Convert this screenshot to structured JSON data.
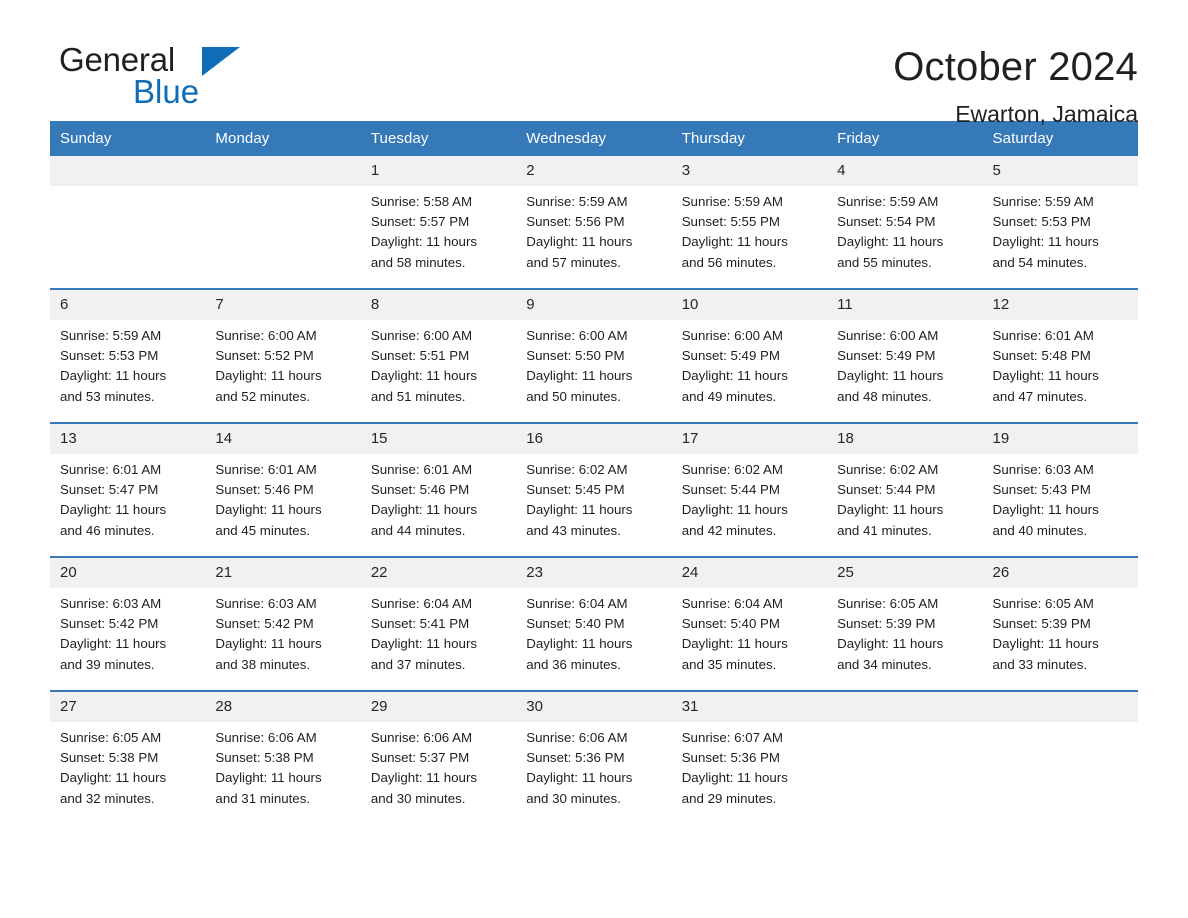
{
  "brand": {
    "name_top": "General",
    "name_bottom": "Blue",
    "triangle_color": "#0f6cb6"
  },
  "header": {
    "title": "October 2024",
    "subtitle": "Ewarton, Jamaica"
  },
  "theme": {
    "header_blue": "#3579b8",
    "row_divider_blue": "#3579b8",
    "daynum_bg": "#f1f1f1",
    "page_bg": "#ffffff"
  },
  "weekday_headers": [
    "Sunday",
    "Monday",
    "Tuesday",
    "Wednesday",
    "Thursday",
    "Friday",
    "Saturday"
  ],
  "weeks": [
    [
      {
        "day": "",
        "lines": []
      },
      {
        "day": "",
        "lines": []
      },
      {
        "day": "1",
        "lines": [
          "Sunrise: 5:58 AM",
          "Sunset: 5:57 PM",
          "Daylight: 11 hours",
          "and 58 minutes."
        ]
      },
      {
        "day": "2",
        "lines": [
          "Sunrise: 5:59 AM",
          "Sunset: 5:56 PM",
          "Daylight: 11 hours",
          "and 57 minutes."
        ]
      },
      {
        "day": "3",
        "lines": [
          "Sunrise: 5:59 AM",
          "Sunset: 5:55 PM",
          "Daylight: 11 hours",
          "and 56 minutes."
        ]
      },
      {
        "day": "4",
        "lines": [
          "Sunrise: 5:59 AM",
          "Sunset: 5:54 PM",
          "Daylight: 11 hours",
          "and 55 minutes."
        ]
      },
      {
        "day": "5",
        "lines": [
          "Sunrise: 5:59 AM",
          "Sunset: 5:53 PM",
          "Daylight: 11 hours",
          "and 54 minutes."
        ]
      }
    ],
    [
      {
        "day": "6",
        "lines": [
          "Sunrise: 5:59 AM",
          "Sunset: 5:53 PM",
          "Daylight: 11 hours",
          "and 53 minutes."
        ]
      },
      {
        "day": "7",
        "lines": [
          "Sunrise: 6:00 AM",
          "Sunset: 5:52 PM",
          "Daylight: 11 hours",
          "and 52 minutes."
        ]
      },
      {
        "day": "8",
        "lines": [
          "Sunrise: 6:00 AM",
          "Sunset: 5:51 PM",
          "Daylight: 11 hours",
          "and 51 minutes."
        ]
      },
      {
        "day": "9",
        "lines": [
          "Sunrise: 6:00 AM",
          "Sunset: 5:50 PM",
          "Daylight: 11 hours",
          "and 50 minutes."
        ]
      },
      {
        "day": "10",
        "lines": [
          "Sunrise: 6:00 AM",
          "Sunset: 5:49 PM",
          "Daylight: 11 hours",
          "and 49 minutes."
        ]
      },
      {
        "day": "11",
        "lines": [
          "Sunrise: 6:00 AM",
          "Sunset: 5:49 PM",
          "Daylight: 11 hours",
          "and 48 minutes."
        ]
      },
      {
        "day": "12",
        "lines": [
          "Sunrise: 6:01 AM",
          "Sunset: 5:48 PM",
          "Daylight: 11 hours",
          "and 47 minutes."
        ]
      }
    ],
    [
      {
        "day": "13",
        "lines": [
          "Sunrise: 6:01 AM",
          "Sunset: 5:47 PM",
          "Daylight: 11 hours",
          "and 46 minutes."
        ]
      },
      {
        "day": "14",
        "lines": [
          "Sunrise: 6:01 AM",
          "Sunset: 5:46 PM",
          "Daylight: 11 hours",
          "and 45 minutes."
        ]
      },
      {
        "day": "15",
        "lines": [
          "Sunrise: 6:01 AM",
          "Sunset: 5:46 PM",
          "Daylight: 11 hours",
          "and 44 minutes."
        ]
      },
      {
        "day": "16",
        "lines": [
          "Sunrise: 6:02 AM",
          "Sunset: 5:45 PM",
          "Daylight: 11 hours",
          "and 43 minutes."
        ]
      },
      {
        "day": "17",
        "lines": [
          "Sunrise: 6:02 AM",
          "Sunset: 5:44 PM",
          "Daylight: 11 hours",
          "and 42 minutes."
        ]
      },
      {
        "day": "18",
        "lines": [
          "Sunrise: 6:02 AM",
          "Sunset: 5:44 PM",
          "Daylight: 11 hours",
          "and 41 minutes."
        ]
      },
      {
        "day": "19",
        "lines": [
          "Sunrise: 6:03 AM",
          "Sunset: 5:43 PM",
          "Daylight: 11 hours",
          "and 40 minutes."
        ]
      }
    ],
    [
      {
        "day": "20",
        "lines": [
          "Sunrise: 6:03 AM",
          "Sunset: 5:42 PM",
          "Daylight: 11 hours",
          "and 39 minutes."
        ]
      },
      {
        "day": "21",
        "lines": [
          "Sunrise: 6:03 AM",
          "Sunset: 5:42 PM",
          "Daylight: 11 hours",
          "and 38 minutes."
        ]
      },
      {
        "day": "22",
        "lines": [
          "Sunrise: 6:04 AM",
          "Sunset: 5:41 PM",
          "Daylight: 11 hours",
          "and 37 minutes."
        ]
      },
      {
        "day": "23",
        "lines": [
          "Sunrise: 6:04 AM",
          "Sunset: 5:40 PM",
          "Daylight: 11 hours",
          "and 36 minutes."
        ]
      },
      {
        "day": "24",
        "lines": [
          "Sunrise: 6:04 AM",
          "Sunset: 5:40 PM",
          "Daylight: 11 hours",
          "and 35 minutes."
        ]
      },
      {
        "day": "25",
        "lines": [
          "Sunrise: 6:05 AM",
          "Sunset: 5:39 PM",
          "Daylight: 11 hours",
          "and 34 minutes."
        ]
      },
      {
        "day": "26",
        "lines": [
          "Sunrise: 6:05 AM",
          "Sunset: 5:39 PM",
          "Daylight: 11 hours",
          "and 33 minutes."
        ]
      }
    ],
    [
      {
        "day": "27",
        "lines": [
          "Sunrise: 6:05 AM",
          "Sunset: 5:38 PM",
          "Daylight: 11 hours",
          "and 32 minutes."
        ]
      },
      {
        "day": "28",
        "lines": [
          "Sunrise: 6:06 AM",
          "Sunset: 5:38 PM",
          "Daylight: 11 hours",
          "and 31 minutes."
        ]
      },
      {
        "day": "29",
        "lines": [
          "Sunrise: 6:06 AM",
          "Sunset: 5:37 PM",
          "Daylight: 11 hours",
          "and 30 minutes."
        ]
      },
      {
        "day": "30",
        "lines": [
          "Sunrise: 6:06 AM",
          "Sunset: 5:36 PM",
          "Daylight: 11 hours",
          "and 30 minutes."
        ]
      },
      {
        "day": "31",
        "lines": [
          "Sunrise: 6:07 AM",
          "Sunset: 5:36 PM",
          "Daylight: 11 hours",
          "and 29 minutes."
        ]
      },
      {
        "day": "",
        "lines": []
      },
      {
        "day": "",
        "lines": []
      }
    ]
  ]
}
